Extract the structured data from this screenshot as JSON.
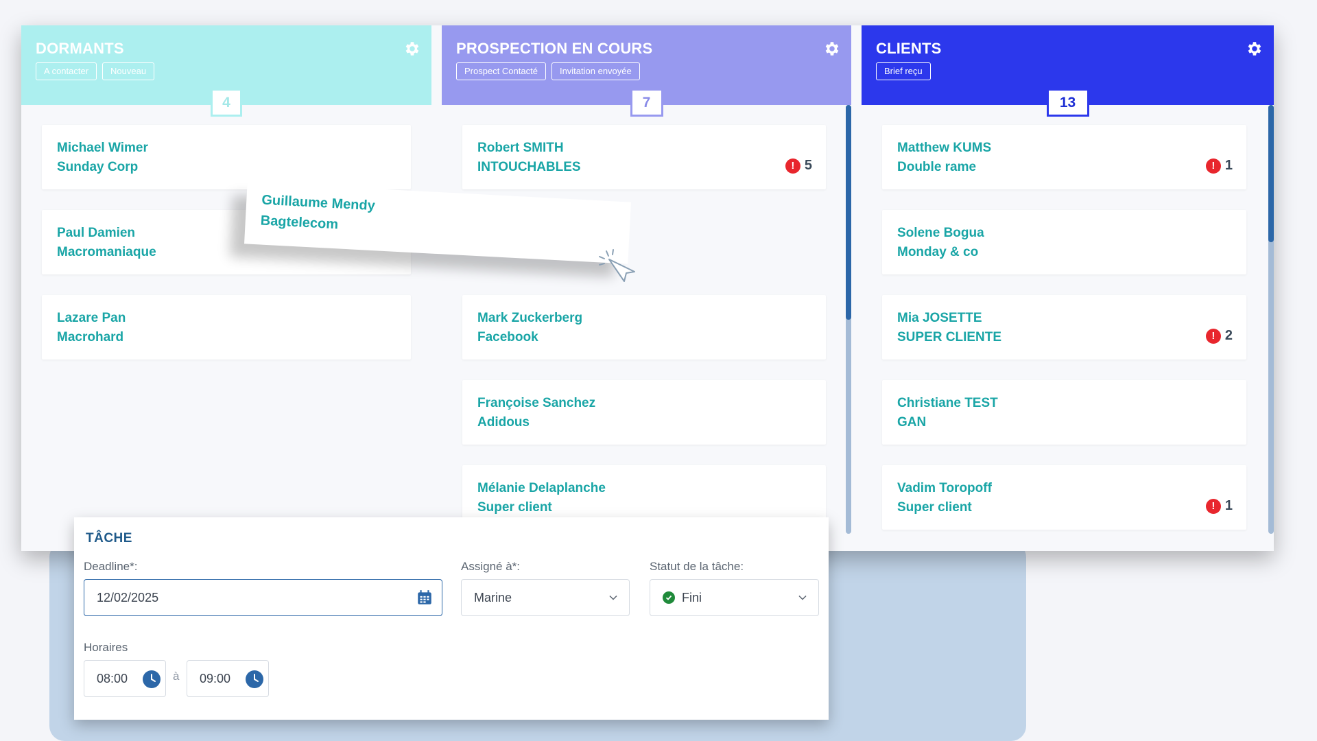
{
  "columns": [
    {
      "title": "DORMANTS",
      "tags": [
        "A contacter",
        "Nouveau"
      ],
      "count": "4",
      "cards": [
        {
          "name": "Michael Wimer",
          "company": "Sunday Corp",
          "alerts": ""
        },
        {
          "name": "Paul Damien",
          "company": "Macromaniaque",
          "alerts": ""
        },
        {
          "name": "Lazare Pan",
          "company": "Macrohard",
          "alerts": ""
        }
      ]
    },
    {
      "title": "PROSPECTION EN COURS",
      "tags": [
        "Prospect Contacté",
        "Invitation envoyée"
      ],
      "count": "7",
      "cards": [
        {
          "name": "Robert SMITH",
          "company": "INTOUCHABLES",
          "alerts": "5"
        },
        {
          "name": "Mark Zuckerberg",
          "company": "Facebook",
          "alerts": ""
        },
        {
          "name": "Françoise Sanchez",
          "company": "Adidous",
          "alerts": ""
        },
        {
          "name": "Mélanie Delaplanche",
          "company": "Super client",
          "alerts": ""
        }
      ]
    },
    {
      "title": "CLIENTS",
      "tags": [
        "Brief reçu"
      ],
      "count": "13",
      "cards": [
        {
          "name": "Matthew KUMS",
          "company": "Double rame",
          "alerts": "1"
        },
        {
          "name": "Solene Bogua",
          "company": "Monday & co",
          "alerts": ""
        },
        {
          "name": "Mia JOSETTE",
          "company": "SUPER CLIENTE",
          "alerts": "2"
        },
        {
          "name": "Christiane TEST",
          "company": "GAN",
          "alerts": ""
        },
        {
          "name": "Vadim Toropoff",
          "company": "Super client",
          "alerts": "1"
        }
      ]
    }
  ],
  "dragged_card": {
    "name": "Guillaume Mendy",
    "company": "Bagtelecom"
  },
  "task": {
    "title": "TÂCHE",
    "deadline_label": "Deadline*:",
    "deadline_value": "12/02/2025",
    "assigned_label": "Assigné à*:",
    "assigned_value": "Marine",
    "status_label": "Statut de la tâche:",
    "status_value": "Fini",
    "hours_label": "Horaires",
    "start_time": "08:00",
    "separator": "à",
    "end_time": "09:00"
  },
  "colors": {
    "dormants": "#acefef",
    "prospection": "#9799ef",
    "clients": "#2c38ec",
    "card_text": "#19a5a6",
    "alert": "#e8262d",
    "status_done": "#1f8a3a"
  },
  "icons": {
    "gear": "gear-icon",
    "alert": "alert-icon",
    "calendar": "calendar-icon",
    "clock": "clock-icon",
    "chevron": "chevron-down-icon",
    "cursor": "cursor-click-icon",
    "check": "check-circle-icon"
  }
}
